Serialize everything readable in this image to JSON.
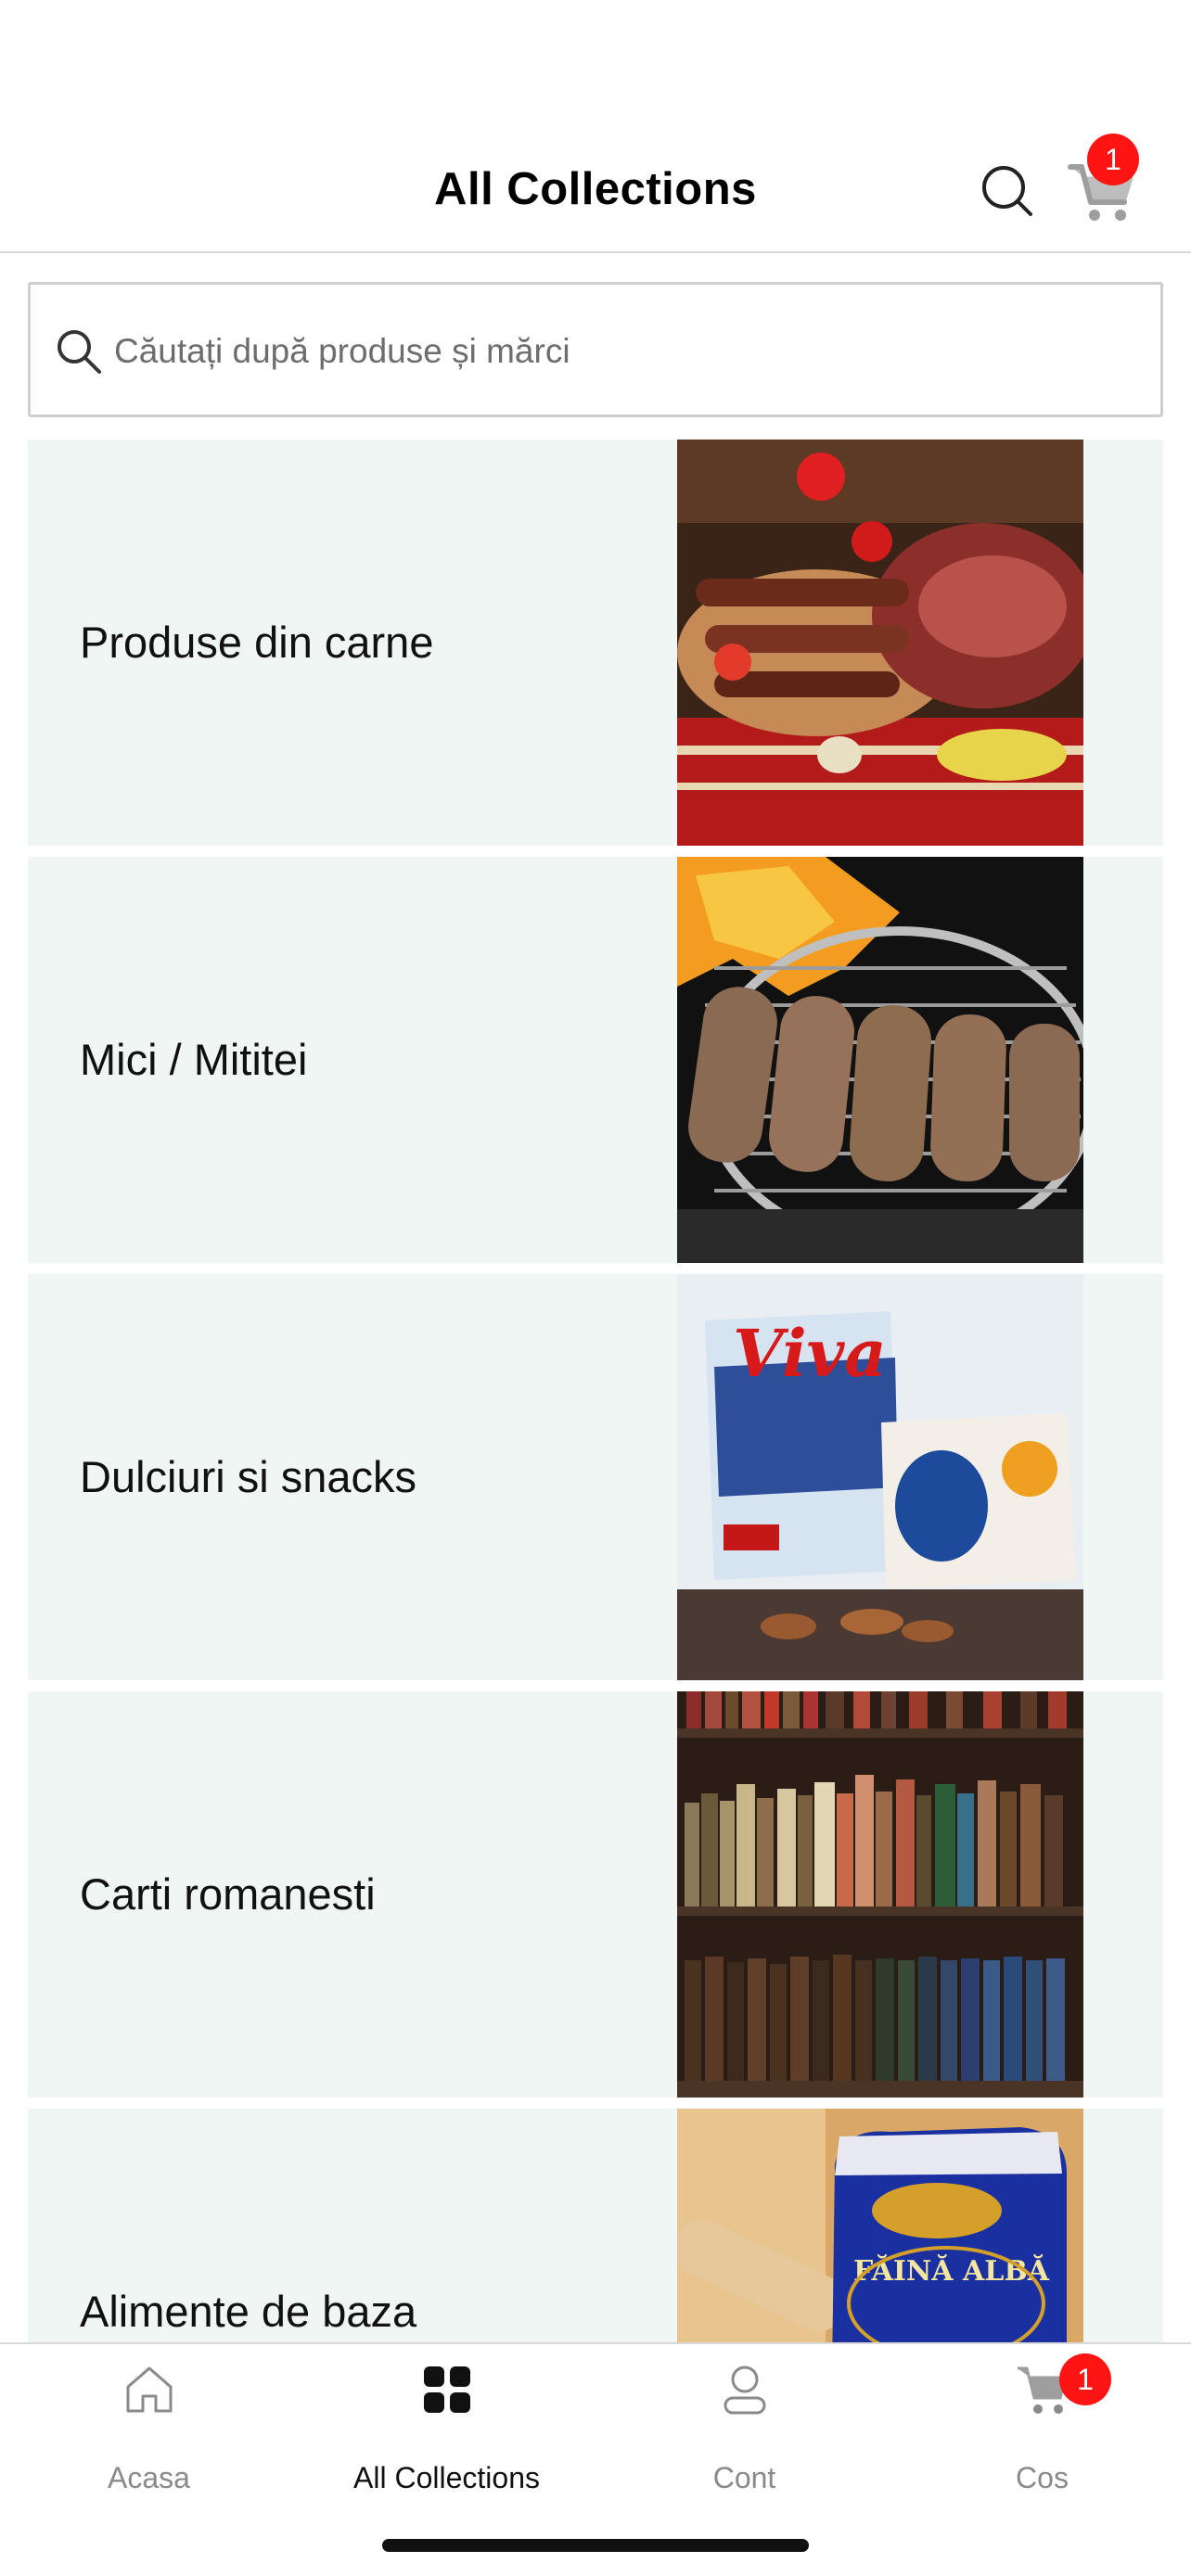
{
  "header": {
    "title": "All Collections",
    "cart_count": "1"
  },
  "search": {
    "placeholder": "Căutați după produse și mărci"
  },
  "collections": [
    {
      "label": "Produse din carne",
      "image": "cured meats and sausages platter"
    },
    {
      "label": "Mici / Mititei",
      "image": "grilled mici on barbecue grate"
    },
    {
      "label": "Dulciuri si snacks",
      "image": "Viva and Ola snack bags"
    },
    {
      "label": "Carti romanesti",
      "image": "bookshelf with old books"
    },
    {
      "label": "Alimente de baza",
      "image": "Boromir flour bag"
    }
  ],
  "tabs": [
    {
      "label": "Acasa",
      "icon": "home-icon"
    },
    {
      "label": "All Collections",
      "icon": "grid-icon"
    },
    {
      "label": "Cont",
      "icon": "user-icon"
    },
    {
      "label": "Cos",
      "icon": "cart-icon"
    }
  ],
  "tabbar": {
    "cart_count": "1"
  },
  "colors": {
    "badge": "#ff1414",
    "tile_bg": "#f0f6f3",
    "active_tab": "#111111",
    "inactive_tab": "#8a8a8a"
  }
}
